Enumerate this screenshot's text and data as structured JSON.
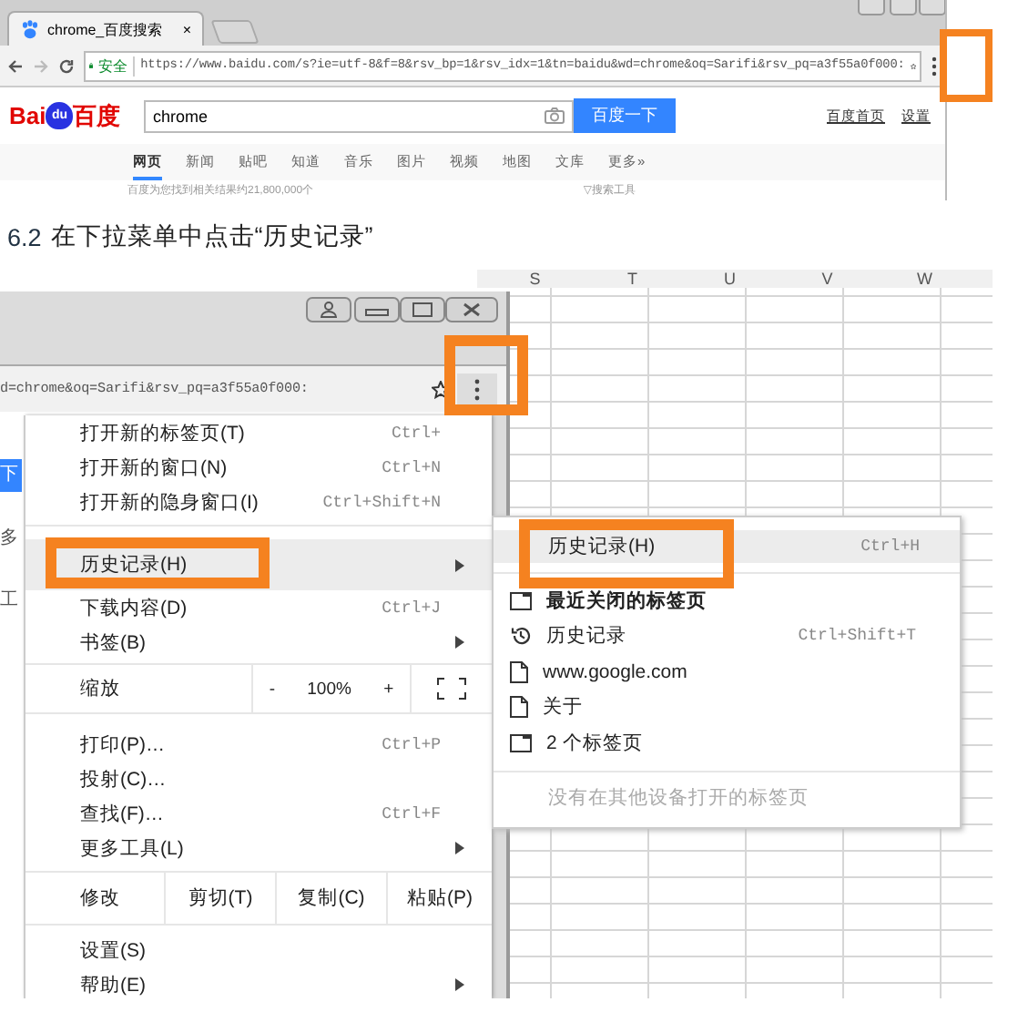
{
  "top_screenshot": {
    "tab": {
      "title": "chrome_百度搜索",
      "close": "×"
    },
    "address_bar": {
      "secure_label": "安全",
      "url": "https://www.baidu.com/s?ie=utf-8&f=8&rsv_bp=1&rsv_idx=1&tn=baidu&wd=chrome&oq=Sarifi&rsv_pq=a3f55a0f000:"
    },
    "logo": {
      "left": "Bai",
      "paw": "du",
      "right": "百度"
    },
    "search": {
      "value": "chrome",
      "button": "百度一下"
    },
    "header_links": [
      "百度首页",
      "设置"
    ],
    "nav_tabs": [
      {
        "label": "网页",
        "selected": true
      },
      {
        "label": "新闻",
        "selected": false
      },
      {
        "label": "贴吧",
        "selected": false
      },
      {
        "label": "知道",
        "selected": false
      },
      {
        "label": "音乐",
        "selected": false
      },
      {
        "label": "图片",
        "selected": false
      },
      {
        "label": "视频",
        "selected": false
      },
      {
        "label": "地图",
        "selected": false
      },
      {
        "label": "文库",
        "selected": false
      },
      {
        "label": "更多»",
        "selected": false
      }
    ],
    "result_count": "百度为您找到相关结果约21,800,000个",
    "search_tools": "▽搜索工具"
  },
  "step_caption": {
    "number": "6.2",
    "text": "在下拉菜单中点击“历史记录”"
  },
  "menu_screenshot": {
    "spreadsheet_columns": [
      "S",
      "T",
      "U",
      "V",
      "W"
    ],
    "url_fragment": "d=chrome&oq=Sarifi&rsv_pq=a3f55a0f000:",
    "page_fragments": [
      {
        "kind": "button",
        "text": "下"
      },
      {
        "kind": "text",
        "text": "多"
      },
      {
        "kind": "text",
        "text": "工"
      }
    ],
    "menu": {
      "items": [
        {
          "kind": "item",
          "label": "打开新的标签页(T)",
          "shortcut": "Ctrl+",
          "submenu": false,
          "highlighted": false
        },
        {
          "kind": "item",
          "label": "打开新的窗口(N)",
          "shortcut": "Ctrl+N",
          "submenu": false,
          "highlighted": false
        },
        {
          "kind": "item",
          "label": "打开新的隐身窗口(I)",
          "shortcut": "Ctrl+Shift+N",
          "submenu": false,
          "highlighted": false
        },
        {
          "kind": "separator"
        },
        {
          "kind": "item",
          "label": "历史记录(H)",
          "submenu": true,
          "highlighted": true
        },
        {
          "kind": "item",
          "label": "下载内容(D)",
          "shortcut": "Ctrl+J",
          "submenu": false,
          "highlighted": false
        },
        {
          "kind": "item",
          "label": "书签(B)",
          "submenu": true,
          "highlighted": false
        },
        {
          "kind": "zoom",
          "label": "缩放",
          "minus": "-",
          "value": "100%",
          "plus": "+"
        },
        {
          "kind": "item",
          "label": "打印(P)…",
          "shortcut": "Ctrl+P",
          "submenu": false,
          "highlighted": false
        },
        {
          "kind": "item",
          "label": "投射(C)…",
          "submenu": false,
          "highlighted": false
        },
        {
          "kind": "item",
          "label": "查找(F)…",
          "shortcut": "Ctrl+F",
          "submenu": false,
          "highlighted": false
        },
        {
          "kind": "item",
          "label": "更多工具(L)",
          "submenu": true,
          "highlighted": false
        },
        {
          "kind": "edit",
          "label": "修改",
          "buttons": [
            "剪切(T)",
            "复制(C)",
            "粘贴(P)"
          ]
        },
        {
          "kind": "item",
          "label": "设置(S)",
          "submenu": false,
          "highlighted": false
        },
        {
          "kind": "item",
          "label": "帮助(E)",
          "submenu": true,
          "highlighted": false
        }
      ]
    },
    "history_submenu": {
      "items": [
        {
          "kind": "header",
          "label": "历史记录(H)",
          "shortcut": "Ctrl+H",
          "highlighted": true
        },
        {
          "kind": "separator"
        },
        {
          "kind": "tab",
          "label": "最近关闭的标签页",
          "bold": true
        },
        {
          "kind": "history",
          "label": "历史记录",
          "shortcut": "Ctrl+Shift+T",
          "bold": false
        },
        {
          "kind": "page",
          "label": "www.google.com",
          "bold": false
        },
        {
          "kind": "page",
          "label": "关于",
          "bold": false
        },
        {
          "kind": "tab",
          "label": "2 个标签页",
          "bold": false
        },
        {
          "kind": "separator"
        },
        {
          "kind": "note",
          "label": "没有在其他设备打开的标签页"
        }
      ]
    }
  }
}
